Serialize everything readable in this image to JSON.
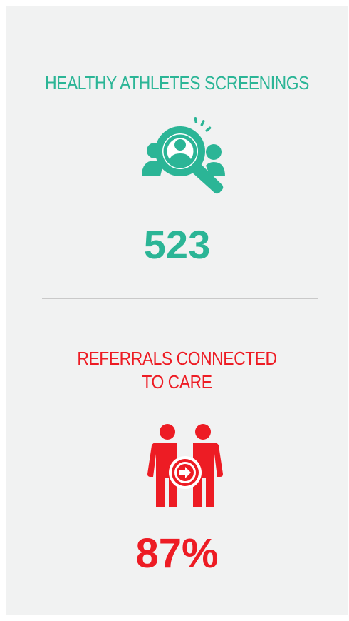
{
  "screenings": {
    "title": "HEALTHY ATHLETES SCREENINGS",
    "icon": "search-people-icon",
    "value": "523",
    "color": "#2bb596"
  },
  "referrals": {
    "title_line1": "REFERRALS CONNECTED",
    "title_line2": "TO CARE",
    "icon": "referral-people-icon",
    "value": "87%",
    "color": "#ed1c24"
  }
}
